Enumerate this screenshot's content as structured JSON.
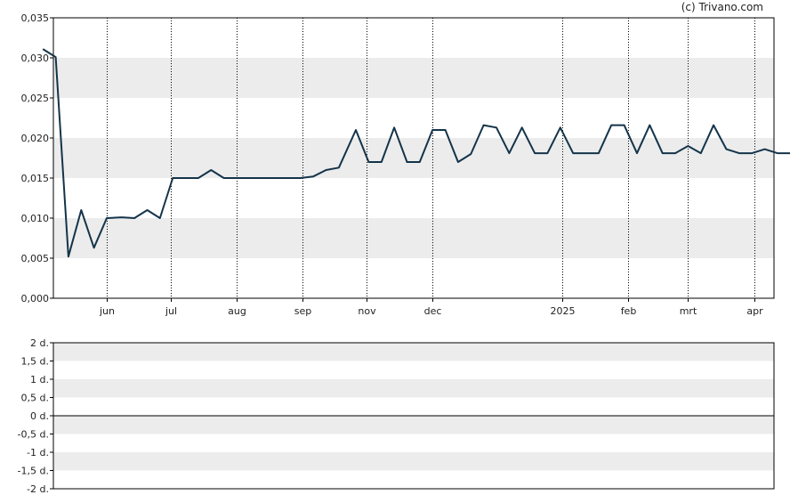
{
  "copyright": "(c) Trivano.com",
  "chart_data": [
    {
      "type": "line",
      "title": "",
      "ylabel": "",
      "xlabel": "",
      "ylim": [
        0,
        0.035
      ],
      "y_ticks": [
        "0,000",
        "0,005",
        "0,010",
        "0,015",
        "0,020",
        "0,025",
        "0,030",
        "0,035"
      ],
      "y_tick_values": [
        0,
        0.005,
        0.01,
        0.015,
        0.02,
        0.025,
        0.03,
        0.035
      ],
      "grid": "dotted vertical lines at month ticks, alternating horizontal bands",
      "x_ticks": [
        "jun",
        "jul",
        "aug",
        "sep",
        "nov",
        "dec",
        "2025",
        "feb",
        "mrt",
        "apr"
      ],
      "x_tick_dates": [
        "2024-06-01",
        "2024-07-01",
        "2024-08-01",
        "2024-09-01",
        "2024-10-01",
        "2024-11-01",
        "2025-01-01",
        "2025-02-01",
        "2025-03-01",
        "2025-04-01"
      ],
      "series": [
        {
          "line_color": "#14344a",
          "dates": [
            "2024-05-02",
            "2024-05-08",
            "2024-05-14",
            "2024-05-20",
            "2024-05-26",
            "2024-06-01",
            "2024-06-08",
            "2024-06-14",
            "2024-06-20",
            "2024-06-26",
            "2024-07-02",
            "2024-07-08",
            "2024-07-14",
            "2024-07-20",
            "2024-07-26",
            "2024-08-01",
            "2024-08-31",
            "2024-09-06",
            "2024-09-12",
            "2024-09-18",
            "2024-09-26",
            "2024-10-02",
            "2024-10-08",
            "2024-10-14",
            "2024-10-20",
            "2024-10-26",
            "2024-11-01",
            "2024-11-07",
            "2024-11-13",
            "2024-11-19",
            "2024-11-25",
            "2024-12-01",
            "2024-12-07",
            "2024-12-13",
            "2024-12-19",
            "2024-12-25",
            "2024-12-31",
            "2025-01-06",
            "2025-01-12",
            "2025-01-18",
            "2025-01-24",
            "2025-01-30",
            "2025-02-05",
            "2025-02-11",
            "2025-02-17",
            "2025-02-23",
            "2025-03-01",
            "2025-03-07",
            "2025-03-13",
            "2025-03-19",
            "2025-03-25",
            "2025-03-31",
            "2025-04-06",
            "2025-04-12",
            "2025-04-18"
          ],
          "values": [
            0.0311,
            0.0301,
            0.0052,
            0.011,
            0.0063,
            0.01,
            0.0101,
            0.01,
            0.011,
            0.01,
            0.015,
            0.015,
            0.015,
            0.016,
            0.015,
            0.015,
            0.015,
            0.0152,
            0.016,
            0.0163,
            0.021,
            0.017,
            0.017,
            0.0213,
            0.017,
            0.017,
            0.021,
            0.021,
            0.017,
            0.018,
            0.0216,
            0.0213,
            0.0181,
            0.0213,
            0.0181,
            0.0181,
            0.0213,
            0.0181,
            0.0181,
            0.0181,
            0.0216,
            0.0216,
            0.0181,
            0.0216,
            0.0181,
            0.0181,
            0.019,
            0.0181,
            0.0216,
            0.0186,
            0.0181,
            0.0181,
            0.0186,
            0.0181,
            0.0181
          ]
        }
      ]
    },
    {
      "type": "line",
      "title": "",
      "ylim": [
        -2,
        2
      ],
      "y_ticks": [
        "2 d.",
        "1,5 d.",
        "1 d.",
        "0,5 d.",
        "0 d.",
        "-0,5 d.",
        "-1 d.",
        "-1,5 d.",
        "-2 d."
      ],
      "y_tick_values": [
        2,
        1.5,
        1,
        0.5,
        0,
        -0.5,
        -1,
        -1.5,
        -2
      ],
      "series": [
        {
          "values": [
            0
          ]
        }
      ]
    }
  ]
}
